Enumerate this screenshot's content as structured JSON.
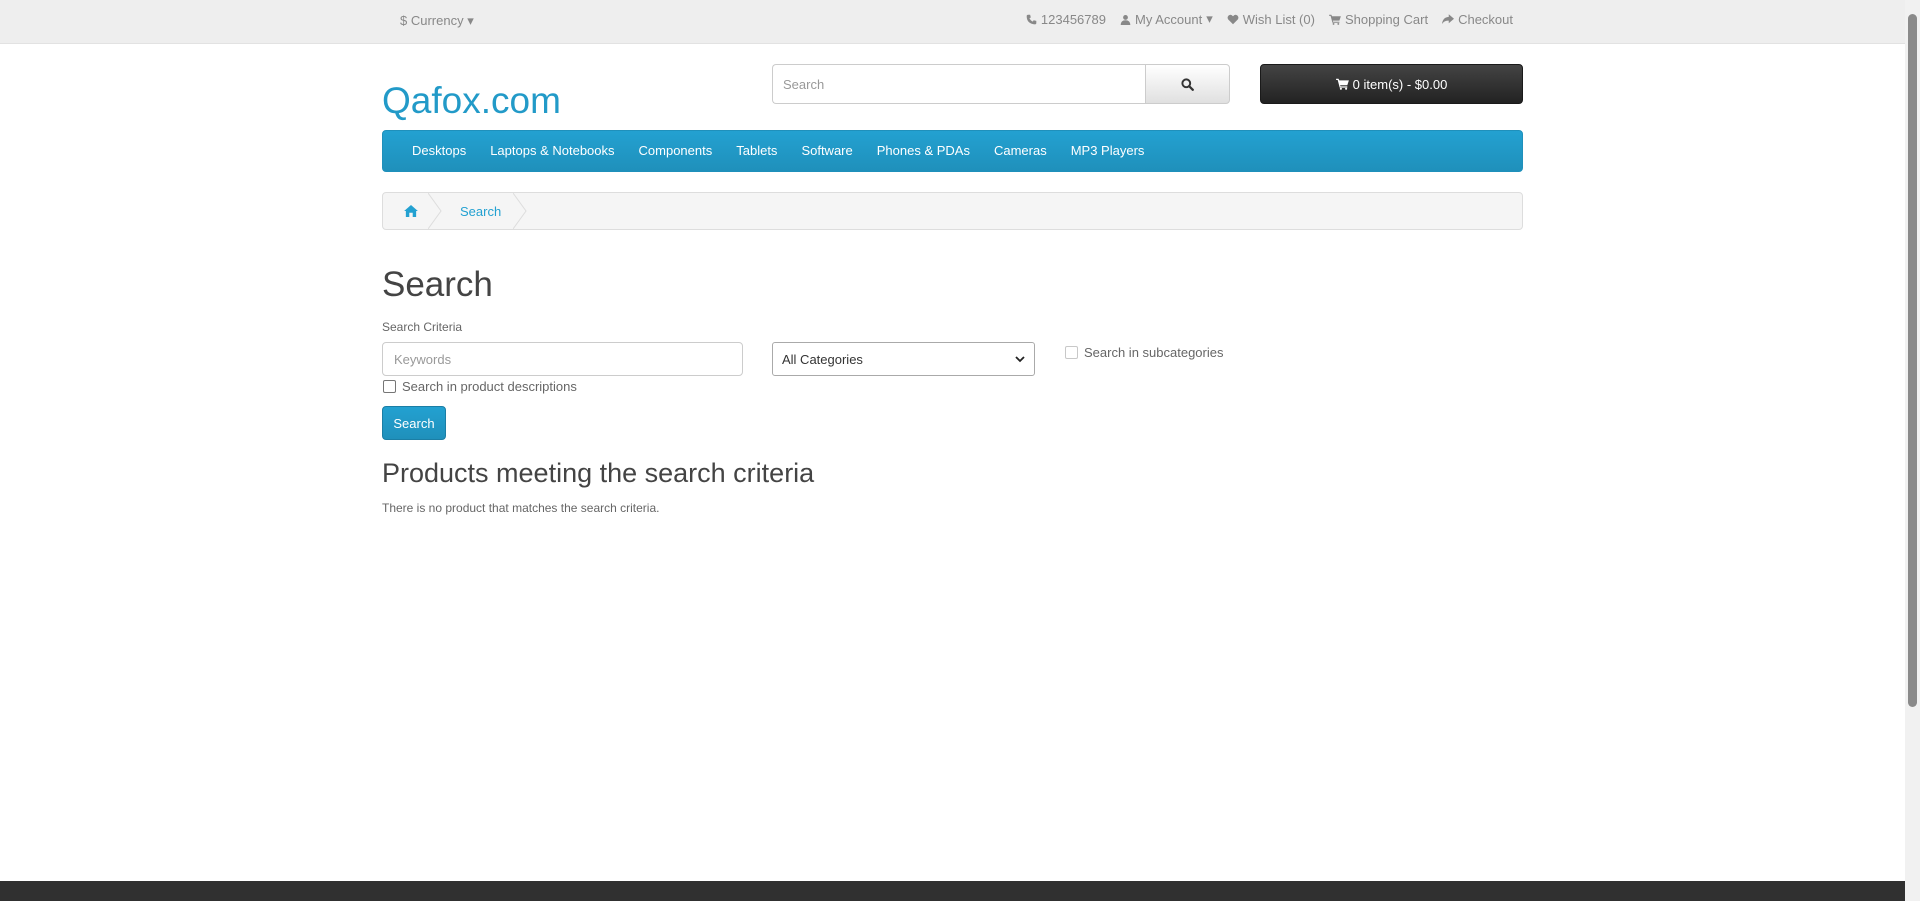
{
  "topbar": {
    "currency": "Currency",
    "currency_symbol": "$",
    "phone": "123456789",
    "my_account": "My Account",
    "wishlist": "Wish List (0)",
    "shopping_cart": "Shopping Cart",
    "checkout": "Checkout"
  },
  "header": {
    "logo": "Qafox.com",
    "search_placeholder": "Search",
    "cart_label": "0 item(s) - $0.00"
  },
  "menu": {
    "items": [
      "Desktops",
      "Laptops & Notebooks",
      "Components",
      "Tablets",
      "Software",
      "Phones & PDAs",
      "Cameras",
      "MP3 Players"
    ]
  },
  "breadcrumb": {
    "current": "Search"
  },
  "search_page": {
    "title": "Search",
    "criteria_label": "Search Criteria",
    "keywords_placeholder": "Keywords",
    "category_selected": "All Categories",
    "subcategories_label": "Search in subcategories",
    "descriptions_label": "Search in product descriptions",
    "search_button": "Search",
    "results_title": "Products meeting the search criteria",
    "no_results": "There is no product that matches the search criteria."
  },
  "colors": {
    "accent": "#229ac8",
    "menu_bg": "#23a1d1",
    "cart_bg": "#303030"
  }
}
